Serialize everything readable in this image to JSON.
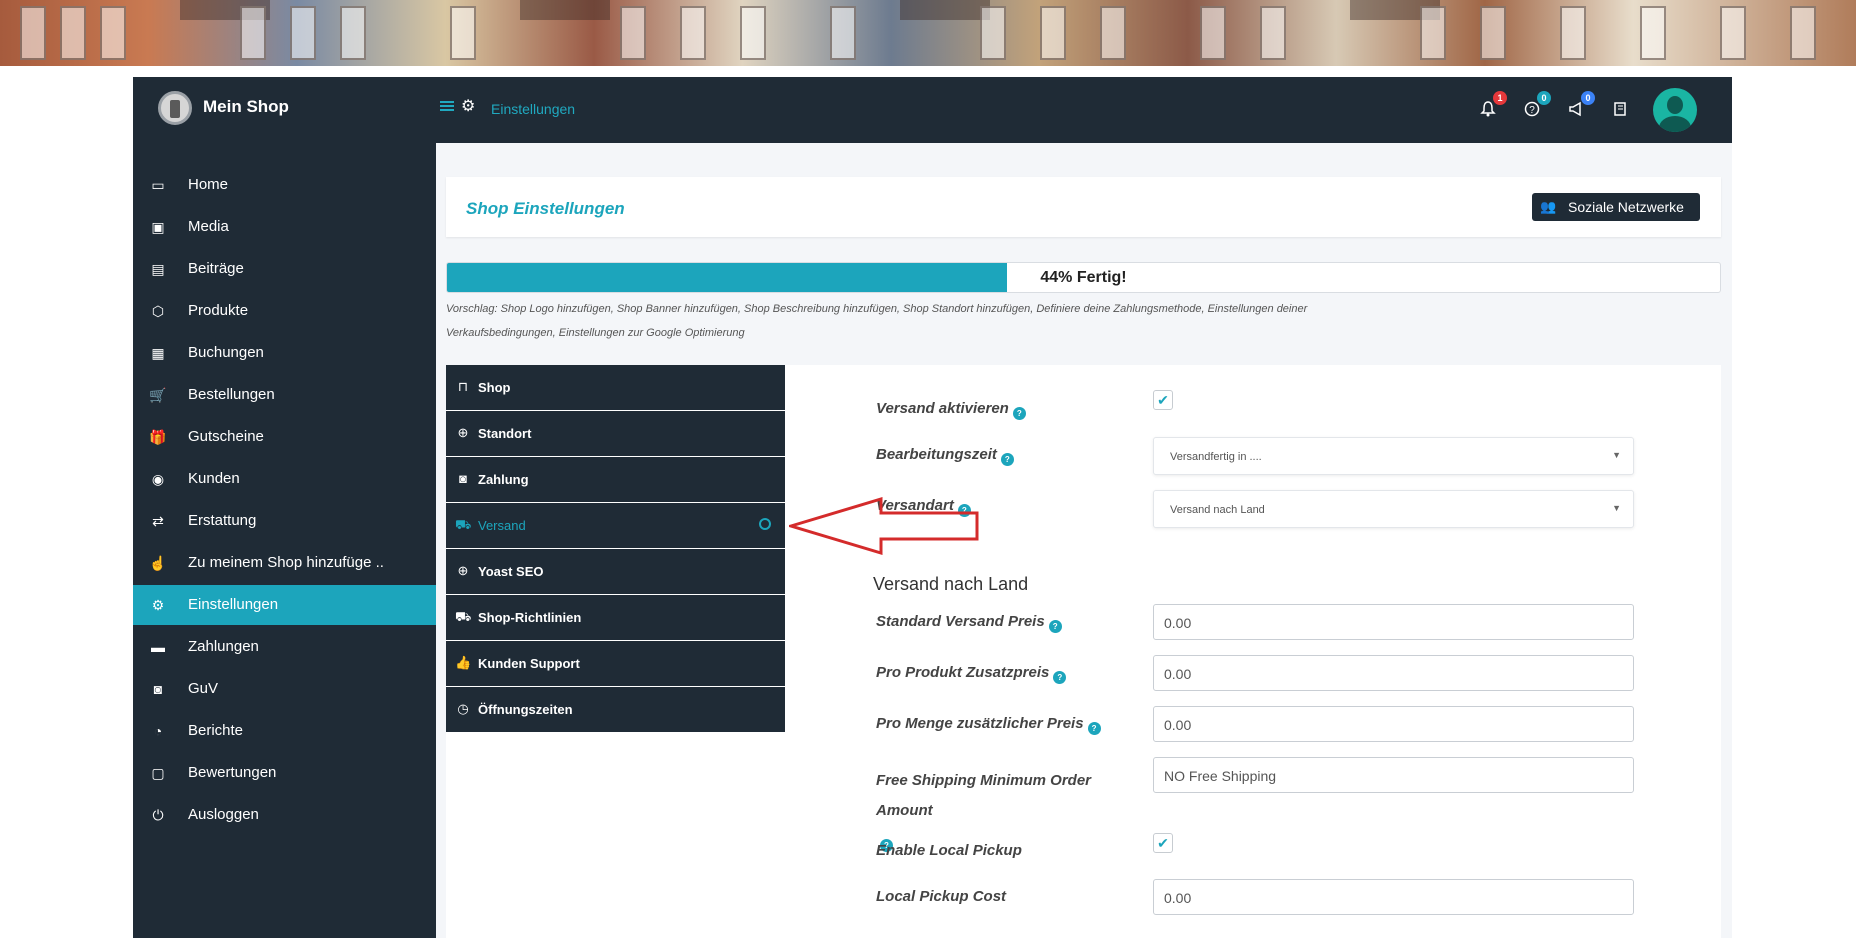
{
  "topbar": {
    "brand_name": "Mein Shop",
    "breadcrumb": "Einstellungen",
    "notifications_count": "1",
    "help_count": "0",
    "announcements_count": "0"
  },
  "sidebar": {
    "items": [
      {
        "label": "Home",
        "icon": "laptop-icon"
      },
      {
        "label": "Media",
        "icon": "image-icon"
      },
      {
        "label": "Beiträge",
        "icon": "document-icon"
      },
      {
        "label": "Produkte",
        "icon": "box-icon"
      },
      {
        "label": "Buchungen",
        "icon": "calendar-icon"
      },
      {
        "label": "Bestellungen",
        "icon": "cart-icon"
      },
      {
        "label": "Gutscheine",
        "icon": "gift-icon"
      },
      {
        "label": "Kunden",
        "icon": "user-circle-icon"
      },
      {
        "label": "Erstattung",
        "icon": "refund-icon"
      },
      {
        "label": "Zu meinem Shop hinzufüge ..",
        "icon": "hand-pointer-icon"
      },
      {
        "label": "Einstellungen",
        "icon": "gears-icon"
      },
      {
        "label": "Zahlungen",
        "icon": "credit-card-icon"
      },
      {
        "label": "GuV",
        "icon": "money-icon"
      },
      {
        "label": "Berichte",
        "icon": "pie-chart-icon"
      },
      {
        "label": "Bewertungen",
        "icon": "comment-icon"
      },
      {
        "label": "Ausloggen",
        "icon": "power-icon"
      }
    ],
    "active_index": 10
  },
  "main": {
    "title": "Shop Einstellungen",
    "social_button": "Soziale Netzwerke",
    "progress_percent": 44,
    "progress_label": "44% Fertig!",
    "hint": "Vorschlag: Shop Logo hinzufügen, Shop Banner hinzufügen, Shop Beschreibung hinzufügen, Shop Standort hinzufügen, Definiere deine Zahlungsmethode, Einstellungen deiner Verkaufsbedingungen, Einstellungen zur Google Optimierung"
  },
  "tabs": [
    {
      "label": "Shop",
      "icon": "bag-icon"
    },
    {
      "label": "Standort",
      "icon": "globe-icon"
    },
    {
      "label": "Zahlung",
      "icon": "money-icon"
    },
    {
      "label": "Versand",
      "icon": "truck-icon"
    },
    {
      "label": "Yoast SEO",
      "icon": "globe-icon"
    },
    {
      "label": "Shop-Richtlinien",
      "icon": "truck-icon"
    },
    {
      "label": "Kunden Support",
      "icon": "thumbs-up-icon"
    },
    {
      "label": "Öffnungszeiten",
      "icon": "clock-icon"
    }
  ],
  "active_tab": 3,
  "form": {
    "enable_shipping_label": "Versand aktivieren",
    "enable_shipping_checked": true,
    "processing_time_label": "Bearbeitungszeit",
    "processing_time_value": "Versandfertig in ....",
    "shipping_type_label": "Versandart",
    "shipping_type_value": "Versand nach Land",
    "section_title": "Versand nach Land",
    "default_price_label": "Standard Versand Preis",
    "default_price_value": "0.00",
    "per_product_label": "Pro Produkt Zusatzpreis",
    "per_product_value": "0.00",
    "per_qty_label": "Pro Menge zusätzlicher Preis",
    "per_qty_value": "0.00",
    "free_shipping_label": "Free Shipping Minimum Order Amount",
    "free_shipping_placeholder": "NO Free Shipping",
    "local_pickup_label": "Enable Local Pickup",
    "local_pickup_checked": true,
    "local_pickup_cost_label": "Local Pickup Cost",
    "local_pickup_cost_value": "0.00"
  },
  "colors": {
    "dark": "#1f2b36",
    "accent": "#1ca5bc",
    "arrow": "#d42b2b"
  }
}
